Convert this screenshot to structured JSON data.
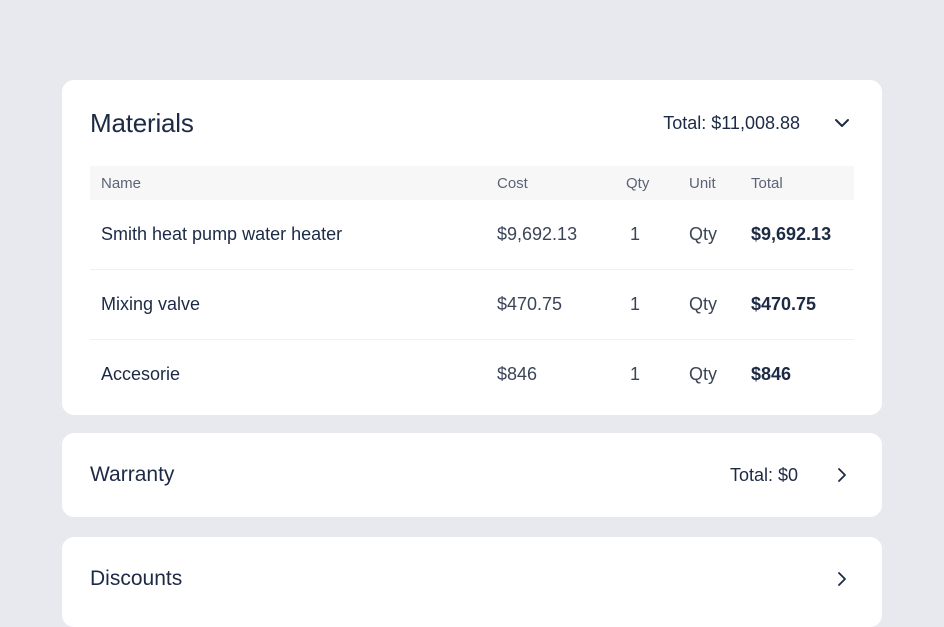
{
  "materials": {
    "title": "Materials",
    "total": "Total: $11,008.88",
    "expand_icon": "chevron-down-icon",
    "columns": [
      "Name",
      "Cost",
      "Qty",
      "Unit",
      "Total"
    ],
    "rows": [
      {
        "name": "Smith heat pump water heater",
        "cost": "$9,692.13",
        "qty": "1",
        "unit": "Qty",
        "total": "$9,692.13"
      },
      {
        "name": "Mixing valve",
        "cost": "$470.75",
        "qty": "1",
        "unit": "Qty",
        "total": "$470.75"
      },
      {
        "name": "Accesorie",
        "cost": "$846",
        "qty": "1",
        "unit": "Qty",
        "total": "$846"
      }
    ]
  },
  "warranty": {
    "title": "Warranty",
    "total": "Total: $0",
    "expand_icon": "chevron-right-icon"
  },
  "discounts": {
    "title": "Discounts",
    "expand_icon": "chevron-right-icon"
  }
}
